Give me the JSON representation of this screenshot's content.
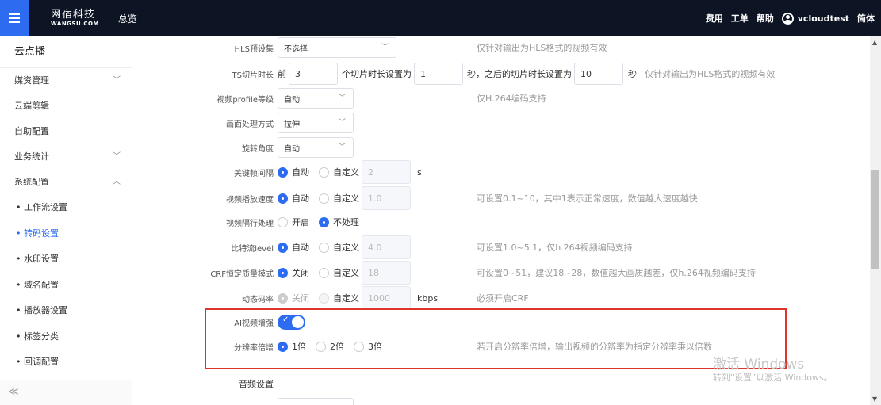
{
  "topbar": {
    "logo_cn": "网宿科技",
    "logo_en": "WANGSU.COM",
    "overview": "总览",
    "links": [
      "费用",
      "工单",
      "帮助"
    ],
    "username": "vcloudtest",
    "language": "简体"
  },
  "sidebar": {
    "title": "云点播",
    "items": [
      {
        "label": "媒资管理"
      },
      {
        "label": "云端剪辑"
      },
      {
        "label": "自助配置"
      },
      {
        "label": "业务统计"
      },
      {
        "label": "系统配置"
      }
    ],
    "subitems": [
      {
        "label": "工作流设置"
      },
      {
        "label": "转码设置"
      },
      {
        "label": "水印设置"
      },
      {
        "label": "域名配置"
      },
      {
        "label": "播放器设置"
      },
      {
        "label": "标签分类"
      },
      {
        "label": "回调配置"
      }
    ],
    "collapse": "≪"
  },
  "form": {
    "hls_preset": {
      "label": "HLS预设集",
      "value": "不选择",
      "hint": "仅针对输出为HLS格式的视频有效"
    },
    "ts_slice": {
      "label": "TS切片时长",
      "prefix": "前",
      "first_count": "3",
      "mid_text": "个切片时长设置为",
      "first_len": "1",
      "after_text": "秒，之后的切片时长设置为",
      "after_len": "10",
      "unit": "秒",
      "hint": "仅针对输出为HLS格式的视频有效"
    },
    "profile": {
      "label": "视频profile等级",
      "value": "自动",
      "hint": "仅H.264编码支持"
    },
    "image_mode": {
      "label": "画面处理方式",
      "value": "拉伸"
    },
    "rotate": {
      "label": "旋转角度",
      "value": "自动"
    },
    "gop": {
      "label": "关键帧间隔",
      "auto": "自动",
      "custom": "自定义",
      "value": "2",
      "unit": "s"
    },
    "speed": {
      "label": "视频播放速度",
      "auto": "自动",
      "custom": "自定义",
      "value": "1.0",
      "hint": "可设置0.1~10，其中1表示正常速度，数值越大速度越快"
    },
    "interlace": {
      "label": "视频隔行处理",
      "on": "开启",
      "off": "不处理"
    },
    "level": {
      "label": "比特流level",
      "auto": "自动",
      "custom": "自定义",
      "value": "4.0",
      "hint": "可设置1.0~5.1，仅h.264视频编码支持"
    },
    "crf": {
      "label": "CRF恒定质量模式",
      "off": "关闭",
      "custom": "自定义",
      "value": "18",
      "hint": "可设置0~51，建议18~28，数值越大画质越差，仅h.264视频编码支持"
    },
    "dyn_bitrate": {
      "label": "动态码率",
      "off": "关闭",
      "custom": "自定义",
      "value": "1000",
      "unit": "kbps",
      "hint": "必须开启CRF"
    },
    "ai_enhance": {
      "label": "AI视频增强",
      "check": "✓"
    },
    "sr_multiple": {
      "label": "分辨率倍增",
      "opt1": "1倍",
      "opt2": "2倍",
      "opt3": "3倍",
      "hint": "若开启分辨率倍增，输出视频的分辨率为指定分辨率乘以倍数"
    },
    "audio_section": "音频设置"
  },
  "watermark": {
    "line1": "激活 Windows",
    "line2": "转到\"设置\"以激活 Windows。"
  }
}
